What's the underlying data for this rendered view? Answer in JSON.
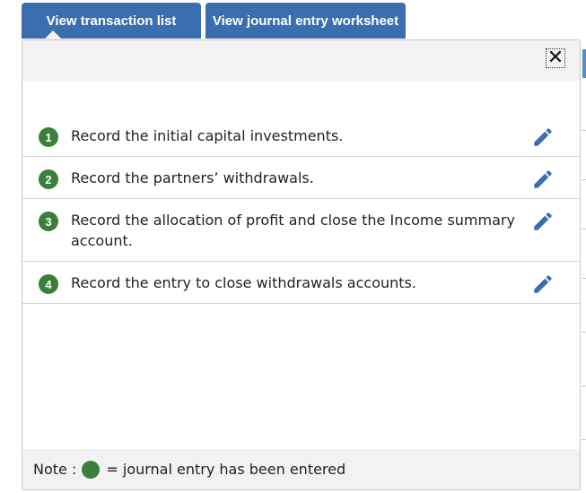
{
  "tabs": {
    "transaction_list": "View transaction list",
    "journal_worksheet": "View journal entry worksheet"
  },
  "panel": {
    "close_symbol": "✕",
    "items": [
      {
        "number": "1",
        "text": "Record the initial capital investments.",
        "icon": "pencil-icon"
      },
      {
        "number": "2",
        "text": "Record the partners’ withdrawals.",
        "icon": "pencil-icon"
      },
      {
        "number": "3",
        "text": "Record the allocation of profit and close the Income summary account.",
        "icon": "pencil-icon"
      },
      {
        "number": "4",
        "text": "Record the entry to close withdrawals accounts.",
        "icon": "pencil-icon"
      }
    ],
    "note_prefix": "Note :",
    "note_suffix": "= journal entry has been entered"
  },
  "colors": {
    "tab_blue": "#3a6eaf",
    "status_green": "#3a7f3a",
    "pencil_blue": "#3a6eaf"
  }
}
